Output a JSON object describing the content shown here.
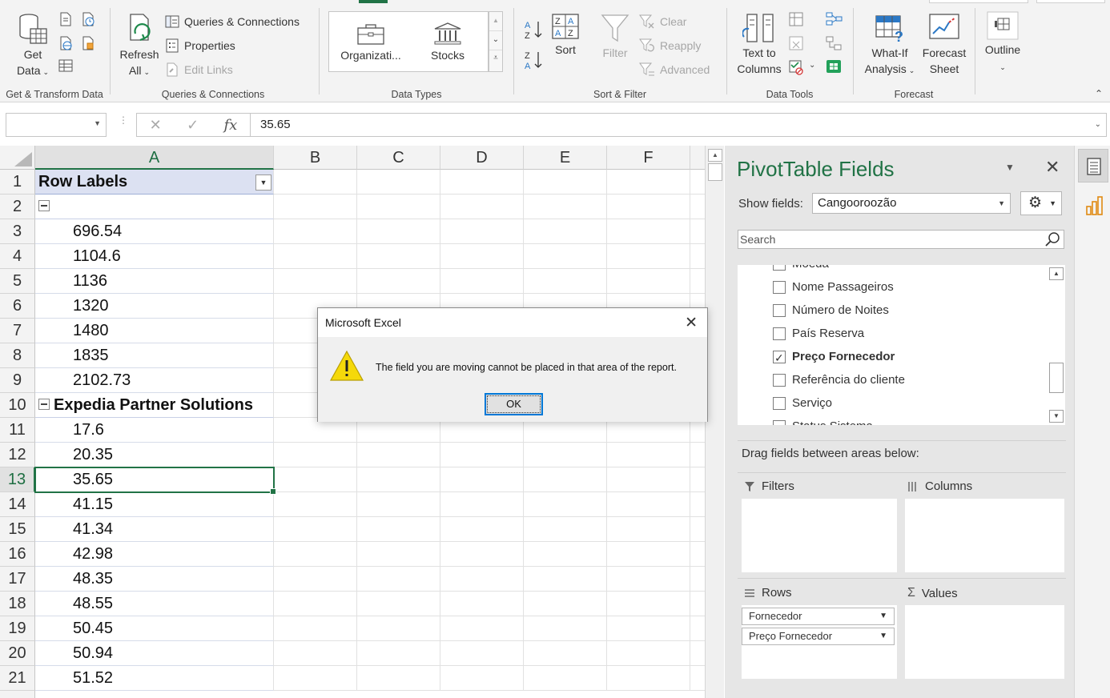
{
  "ribbon": {
    "groups": {
      "get_transform": "Get & Transform Data",
      "queries": "Queries & Connections",
      "data_types": "Data Types",
      "sort_filter": "Sort & Filter",
      "data_tools": "Data Tools",
      "forecast": "Forecast"
    },
    "get_data": {
      "line1": "Get",
      "line2": "Data"
    },
    "refresh_all": {
      "line1": "Refresh",
      "line2": "All"
    },
    "queries_connections": "Queries & Connections",
    "properties": "Properties",
    "edit_links": "Edit Links",
    "organization": "Organizati...",
    "stocks": "Stocks",
    "sort": "Sort",
    "filter": "Filter",
    "clear": "Clear",
    "reapply": "Reapply",
    "advanced": "Advanced",
    "text_to_columns": {
      "line1": "Text to",
      "line2": "Columns"
    },
    "what_if": {
      "line1": "What-If",
      "line2": "Analysis"
    },
    "forecast_sheet": {
      "line1": "Forecast",
      "line2": "Sheet"
    },
    "outline": "Outline"
  },
  "formula_bar": {
    "name_box": "",
    "value": "35.65"
  },
  "grid": {
    "columns": [
      "A",
      "B",
      "C",
      "D",
      "E",
      "F"
    ],
    "selected_column": "A",
    "selected_row": 13,
    "rows": [
      {
        "n": "1",
        "a": "Row Labels",
        "kind": "header"
      },
      {
        "n": "2",
        "a": "",
        "kind": "group"
      },
      {
        "n": "3",
        "a": "696.54",
        "kind": "value"
      },
      {
        "n": "4",
        "a": "1104.6",
        "kind": "value"
      },
      {
        "n": "5",
        "a": "1136",
        "kind": "value"
      },
      {
        "n": "6",
        "a": "1320",
        "kind": "value"
      },
      {
        "n": "7",
        "a": "1480",
        "kind": "value"
      },
      {
        "n": "8",
        "a": "1835",
        "kind": "value"
      },
      {
        "n": "9",
        "a": "2102.73",
        "kind": "value"
      },
      {
        "n": "10",
        "a": "Expedia Partner Solutions",
        "kind": "group"
      },
      {
        "n": "11",
        "a": "17.6",
        "kind": "value"
      },
      {
        "n": "12",
        "a": "20.35",
        "kind": "value"
      },
      {
        "n": "13",
        "a": "35.65",
        "kind": "value"
      },
      {
        "n": "14",
        "a": "41.15",
        "kind": "value"
      },
      {
        "n": "15",
        "a": "41.34",
        "kind": "value"
      },
      {
        "n": "16",
        "a": "42.98",
        "kind": "value"
      },
      {
        "n": "17",
        "a": "48.35",
        "kind": "value"
      },
      {
        "n": "18",
        "a": "48.55",
        "kind": "value"
      },
      {
        "n": "19",
        "a": "50.45",
        "kind": "value"
      },
      {
        "n": "20",
        "a": "50.94",
        "kind": "value"
      },
      {
        "n": "21",
        "a": "51.52",
        "kind": "value"
      }
    ]
  },
  "pivot": {
    "title": "PivotTable Fields",
    "show_fields_label": "Show fields:",
    "show_fields_value": "Cangooroozão",
    "search_placeholder": "Search",
    "fields": [
      {
        "label": "Moeda",
        "checked": false
      },
      {
        "label": "Nome Passageiros",
        "checked": false
      },
      {
        "label": "Número de Noites",
        "checked": false
      },
      {
        "label": "País Reserva",
        "checked": false
      },
      {
        "label": "Preço Fornecedor",
        "checked": true
      },
      {
        "label": "Referência do cliente",
        "checked": false
      },
      {
        "label": "Serviço",
        "checked": false
      },
      {
        "label": "Status Sistema",
        "checked": false
      }
    ],
    "drag_label": "Drag fields between areas below:",
    "areas": {
      "filters": "Filters",
      "columns": "Columns",
      "rows": "Rows",
      "values": "Values"
    },
    "row_fields": [
      "Fornecedor",
      "Preço Fornecedor"
    ]
  },
  "dialog": {
    "title": "Microsoft Excel",
    "message": "The field you are moving cannot be placed in that area of the report.",
    "ok": "OK"
  },
  "colors": {
    "excel_green": "#217346",
    "pivot_header": "#dce1f2",
    "warning": "#f5d90a"
  }
}
